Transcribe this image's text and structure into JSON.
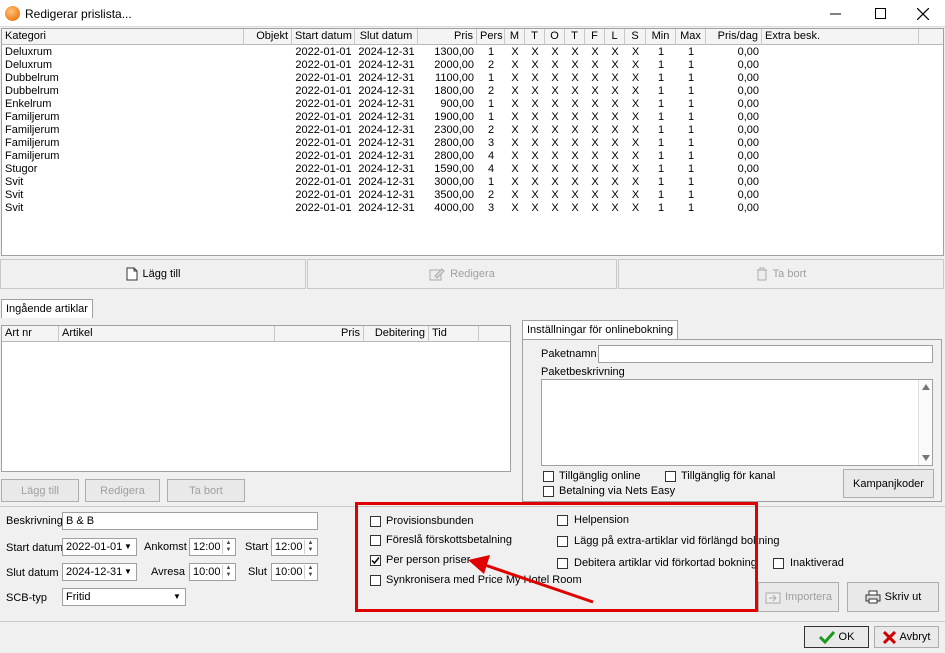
{
  "window": {
    "title": "Redigerar prislista..."
  },
  "grid": {
    "columns": [
      "Kategori",
      "Objekt",
      "Start datum",
      "Slut datum",
      "Pris",
      "Pers",
      "M",
      "T",
      "O",
      "T",
      "F",
      "L",
      "S",
      "Min",
      "Max",
      "Pris/dag",
      "Extra besk."
    ],
    "rows": [
      [
        "Deluxrum",
        "",
        "2022-01-01",
        "2024-12-31",
        "1300,00",
        "1",
        "X",
        "X",
        "X",
        "X",
        "X",
        "X",
        "X",
        "1",
        "1",
        "0,00",
        ""
      ],
      [
        "Deluxrum",
        "",
        "2022-01-01",
        "2024-12-31",
        "2000,00",
        "2",
        "X",
        "X",
        "X",
        "X",
        "X",
        "X",
        "X",
        "1",
        "1",
        "0,00",
        ""
      ],
      [
        "Dubbelrum",
        "",
        "2022-01-01",
        "2024-12-31",
        "1100,00",
        "1",
        "X",
        "X",
        "X",
        "X",
        "X",
        "X",
        "X",
        "1",
        "1",
        "0,00",
        ""
      ],
      [
        "Dubbelrum",
        "",
        "2022-01-01",
        "2024-12-31",
        "1800,00",
        "2",
        "X",
        "X",
        "X",
        "X",
        "X",
        "X",
        "X",
        "1",
        "1",
        "0,00",
        ""
      ],
      [
        "Enkelrum",
        "",
        "2022-01-01",
        "2024-12-31",
        "900,00",
        "1",
        "X",
        "X",
        "X",
        "X",
        "X",
        "X",
        "X",
        "1",
        "1",
        "0,00",
        ""
      ],
      [
        "Familjerum",
        "",
        "2022-01-01",
        "2024-12-31",
        "1900,00",
        "1",
        "X",
        "X",
        "X",
        "X",
        "X",
        "X",
        "X",
        "1",
        "1",
        "0,00",
        ""
      ],
      [
        "Familjerum",
        "",
        "2022-01-01",
        "2024-12-31",
        "2300,00",
        "2",
        "X",
        "X",
        "X",
        "X",
        "X",
        "X",
        "X",
        "1",
        "1",
        "0,00",
        ""
      ],
      [
        "Familjerum",
        "",
        "2022-01-01",
        "2024-12-31",
        "2800,00",
        "3",
        "X",
        "X",
        "X",
        "X",
        "X",
        "X",
        "X",
        "1",
        "1",
        "0,00",
        ""
      ],
      [
        "Familjerum",
        "",
        "2022-01-01",
        "2024-12-31",
        "2800,00",
        "4",
        "X",
        "X",
        "X",
        "X",
        "X",
        "X",
        "X",
        "1",
        "1",
        "0,00",
        ""
      ],
      [
        "Stugor",
        "",
        "2022-01-01",
        "2024-12-31",
        "1590,00",
        "4",
        "X",
        "X",
        "X",
        "X",
        "X",
        "X",
        "X",
        "1",
        "1",
        "0,00",
        ""
      ],
      [
        "Svit",
        "",
        "2022-01-01",
        "2024-12-31",
        "3000,00",
        "1",
        "X",
        "X",
        "X",
        "X",
        "X",
        "X",
        "X",
        "1",
        "1",
        "0,00",
        ""
      ],
      [
        "Svit",
        "",
        "2022-01-01",
        "2024-12-31",
        "3500,00",
        "2",
        "X",
        "X",
        "X",
        "X",
        "X",
        "X",
        "X",
        "1",
        "1",
        "0,00",
        ""
      ],
      [
        "Svit",
        "",
        "2022-01-01",
        "2024-12-31",
        "4000,00",
        "3",
        "X",
        "X",
        "X",
        "X",
        "X",
        "X",
        "X",
        "1",
        "1",
        "0,00",
        ""
      ]
    ]
  },
  "toolbar": {
    "add": "Lägg till",
    "edit": "Redigera",
    "delete": "Ta bort"
  },
  "articles": {
    "tab": "Ingående artiklar",
    "columns": [
      "Art nr",
      "Artikel",
      "Pris",
      "Debitering",
      "Tid"
    ],
    "add": "Lägg till",
    "edit": "Redigera",
    "delete": "Ta bort"
  },
  "online": {
    "tab": "Inställningar för onlinebokning",
    "package_name_label": "Paketnamn",
    "package_name_value": "",
    "package_desc_label": "Paketbeskrivning",
    "available_online": "Tillgänglig online",
    "available_channel": "Tillgänglig för kanal",
    "nets_easy": "Betalning via Nets Easy",
    "campaign_button": "Kampanjkoder"
  },
  "form": {
    "description_label": "Beskrivning",
    "description_value": "B & B",
    "start_date_label": "Start datum",
    "start_date_value": "2022-01-01",
    "end_date_label": "Slut datum",
    "end_date_value": "2024-12-31",
    "scb_label": "SCB-typ",
    "scb_value": "Fritid",
    "arrival_label": "Ankomst",
    "arrival_value": "12:00",
    "departure_label": "Avresa",
    "departure_value": "10:00",
    "start_label": "Start",
    "start_value": "12:00",
    "end_label": "Slut",
    "end_value": "10:00"
  },
  "options": {
    "commission": {
      "label": "Provisionsbunden",
      "checked": false
    },
    "prepayment": {
      "label": "Föreslå förskottsbetalning",
      "checked": false
    },
    "per_person": {
      "label": "Per person priser",
      "checked": true
    },
    "sync": {
      "label": "Synkronisera med Price My Hotel Room",
      "checked": false
    },
    "full_board": {
      "label": "Helpension",
      "checked": false
    },
    "extra_articles": {
      "label": "Lägg på extra-artiklar vid förlängd bokning",
      "checked": false
    },
    "debit_articles": {
      "label": "Debitera artiklar vid förkortad bokning",
      "checked": false
    },
    "inactive": {
      "label": "Inaktiverad",
      "checked": false
    }
  },
  "actions": {
    "import": "Importera",
    "print": "Skriv ut",
    "ok": "OK",
    "cancel": "Avbryt"
  },
  "colors": {
    "highlight_box": "#e00000",
    "annotation_arrow": "#e00000",
    "ok_check": "#1a9a1a",
    "cancel_x": "#cc0000"
  }
}
